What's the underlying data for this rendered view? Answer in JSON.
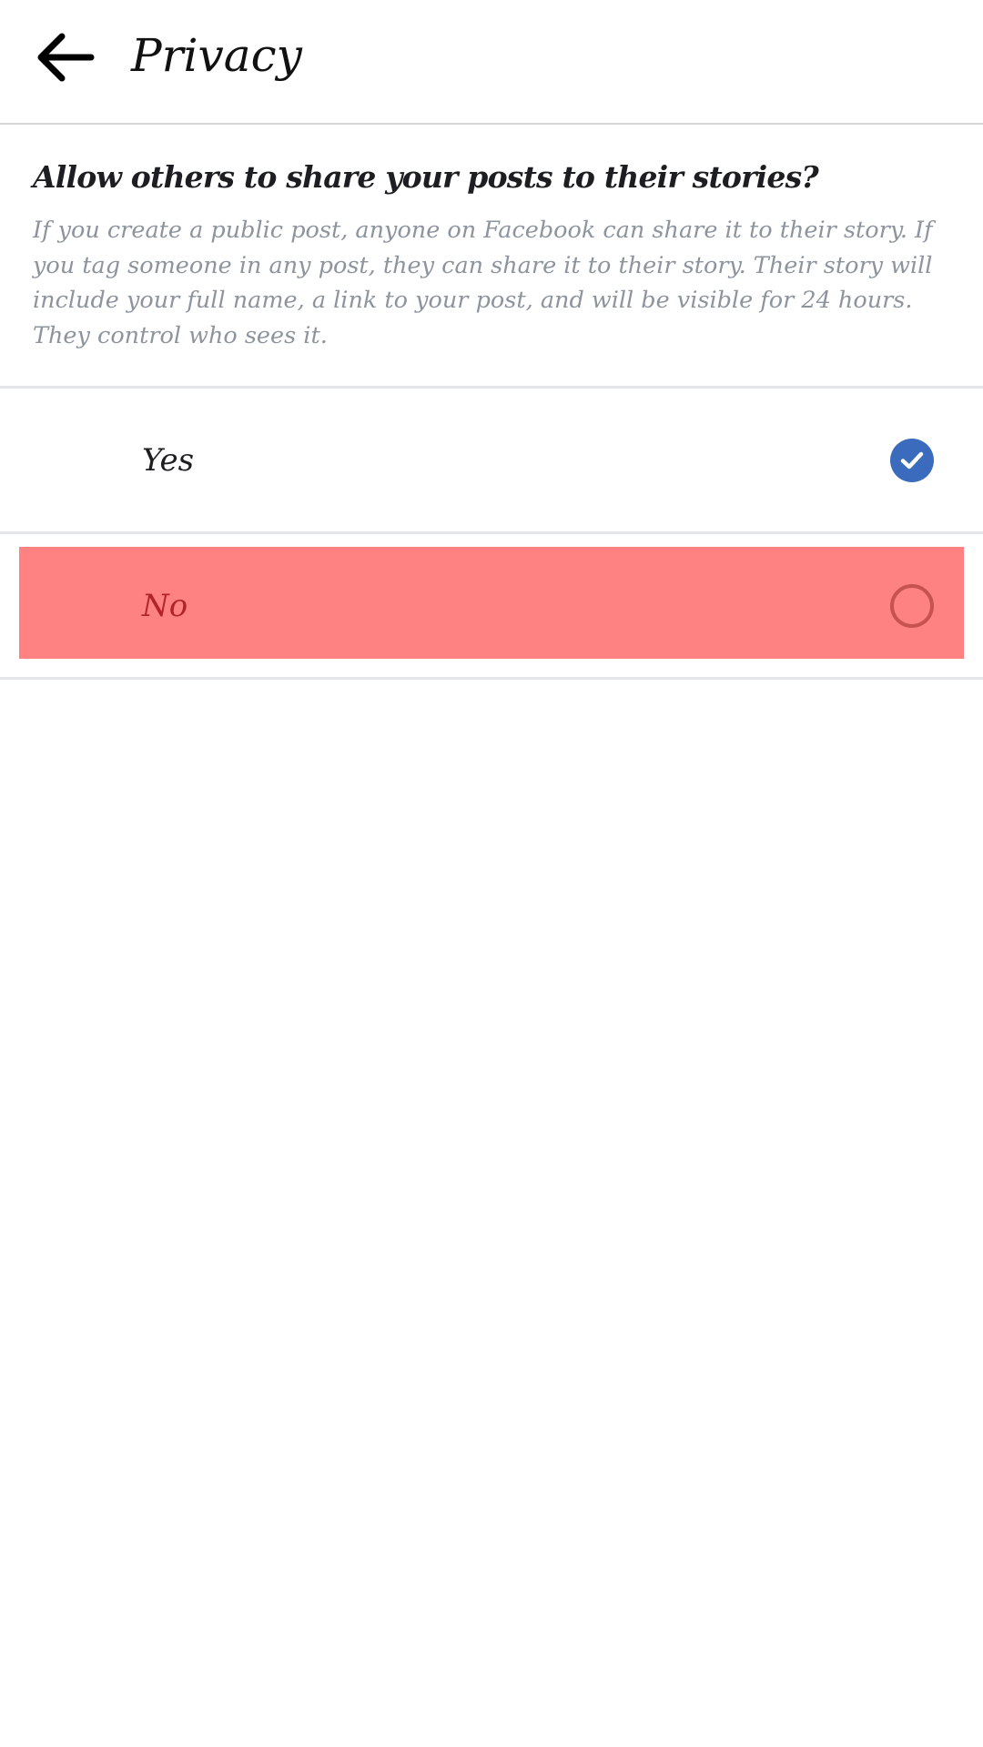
{
  "header": {
    "back_icon": "arrow-left-icon",
    "title": "Privacy"
  },
  "question": {
    "title": "Allow others to share your posts to their stories?",
    "description": "If you create a public post, anyone on Facebook can share it to their story. If you tag someone in any post, they can share it to their story. Their story will include your full name, a link to your post, and will be visible for 24 hours. They control who sees it."
  },
  "options": [
    {
      "label": "Yes",
      "selected": true,
      "icon": "checkmark-circle-icon"
    },
    {
      "label": "No",
      "selected": false,
      "icon": "radio-empty-icon",
      "highlight_color": "#ff8282"
    }
  ],
  "colors": {
    "accent": "#3a6bbd",
    "text_primary": "#1c1e21",
    "text_secondary": "#8d949e",
    "divider": "#e4e6ea"
  }
}
